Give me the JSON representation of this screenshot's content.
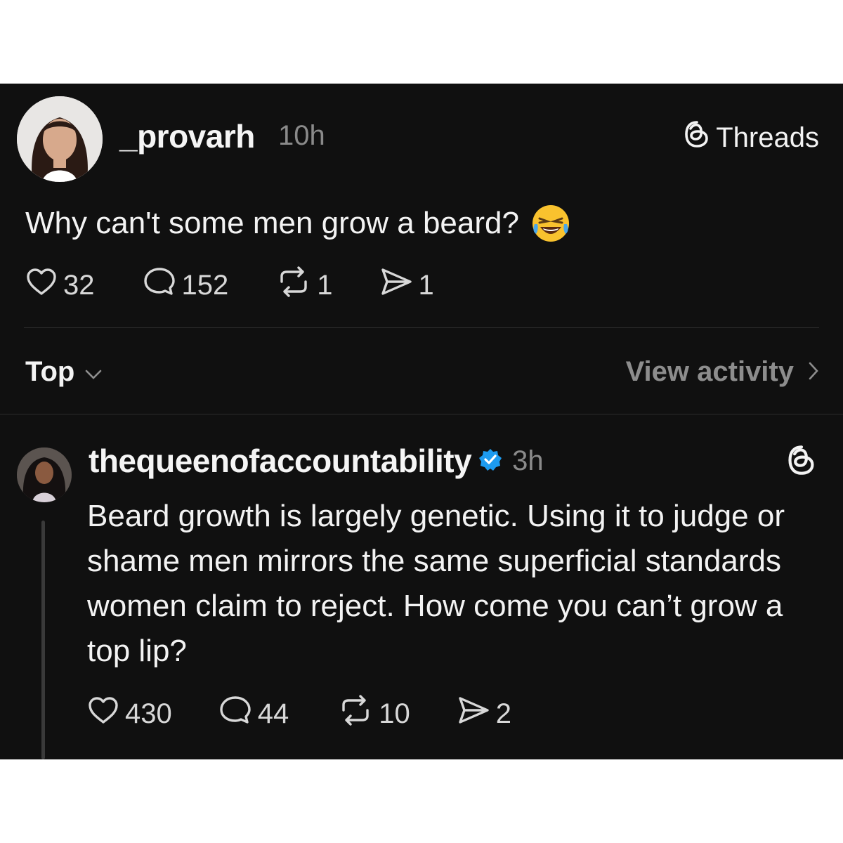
{
  "post": {
    "username": "_provarh",
    "time": "10h",
    "platform_label": "Threads",
    "text": "Why can't some men grow a beard?",
    "emoji": "face-with-tears-of-joy",
    "stats": {
      "likes": "32",
      "replies": "152",
      "reposts": "1",
      "shares": "1"
    }
  },
  "sort": {
    "label": "Top",
    "view_activity": "View activity"
  },
  "reply": {
    "username": "thequeenofaccountability",
    "verified": true,
    "time": "3h",
    "text": "Beard growth is largely genetic. Using it to judge or shame men mirrors the same superficial standards women claim to reject. How come you can’t grow a top lip?",
    "stats": {
      "likes": "430",
      "replies": "44",
      "reposts": "10",
      "shares": "2"
    }
  },
  "colors": {
    "background": "#101010",
    "text": "#f3f3f3",
    "muted": "#8a8a8a",
    "verified": "#1d9bf0"
  }
}
